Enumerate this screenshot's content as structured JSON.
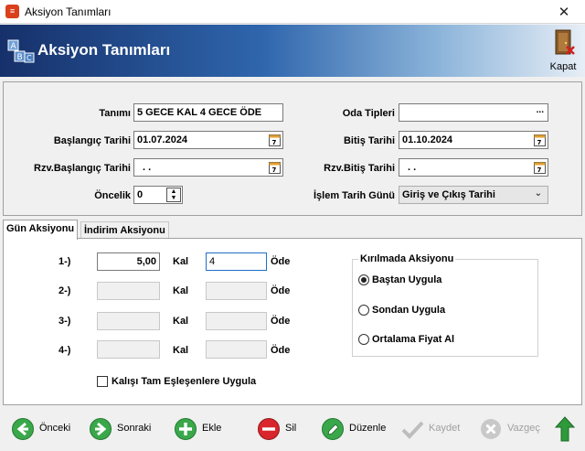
{
  "window": {
    "title": "Aksiyon Tanımları",
    "close_glyph": "✕"
  },
  "banner": {
    "title": "Aksiyon Tanımları",
    "close_label": "Kapat"
  },
  "form": {
    "tanimi_label": "Tanımı",
    "tanimi_value": "5 GECE KAL 4 GECE ÖDE",
    "baslangic_label": "Başlangıç Tarihi",
    "baslangic_value": "01.07.2024",
    "rzv_baslangic_label": "Rzv.Başlangıç Tarihi",
    "rzv_baslangic_value": ". .",
    "oncelik_label": "Öncelik",
    "oncelik_value": "0",
    "oda_tipleri_label": "Oda Tipleri",
    "oda_tipleri_value": "",
    "oda_tipleri_button": "...",
    "bitis_label": "Bitiş Tarihi",
    "bitis_value": "01.10.2024",
    "rzv_bitis_label": "Rzv.Bitiş Tarihi",
    "rzv_bitis_value": ". .",
    "islem_label": "İşlem Tarih Günü",
    "islem_value": "Giriş ve Çıkış Tarihi"
  },
  "tabs": [
    {
      "label": "Gün Aksiyonu",
      "active": true
    },
    {
      "label": "İndirim Aksiyonu",
      "active": false
    }
  ],
  "gun_aksiyonu": {
    "rows": [
      {
        "label": "1-)",
        "kal_value": "5,00",
        "kal_label": "Kal",
        "ode_value": "4",
        "ode_label": "Öde",
        "enabled": true
      },
      {
        "label": "2-)",
        "kal_value": "",
        "kal_label": "Kal",
        "ode_value": "",
        "ode_label": "Öde",
        "enabled": false
      },
      {
        "label": "3-)",
        "kal_value": "",
        "kal_label": "Kal",
        "ode_value": "",
        "ode_label": "Öde",
        "enabled": false
      },
      {
        "label": "4-)",
        "kal_value": "",
        "kal_label": "Kal",
        "ode_value": "",
        "ode_label": "Öde",
        "enabled": false
      }
    ],
    "checkbox_label": "Kalışı Tam Eşleşenlere Uygula",
    "checkbox_checked": false,
    "kirilmada": {
      "title": "Kırılmada Aksiyonu",
      "options": [
        {
          "label": "Baştan Uygula",
          "selected": true
        },
        {
          "label": "Sondan Uygula",
          "selected": false
        },
        {
          "label": "Ortalama Fiyat Al",
          "selected": false
        }
      ]
    }
  },
  "toolbar": {
    "onceki": "Önceki",
    "sonraki": "Sonraki",
    "ekle": "Ekle",
    "sil": "Sil",
    "duzenle": "Düzenle",
    "kaydet": "Kaydet",
    "vazgec": "Vazgeç"
  },
  "colors": {
    "banner_start": "#16306a",
    "banner_end": "#e7eef6",
    "green": "#3aa84a",
    "red": "#d8262c"
  }
}
